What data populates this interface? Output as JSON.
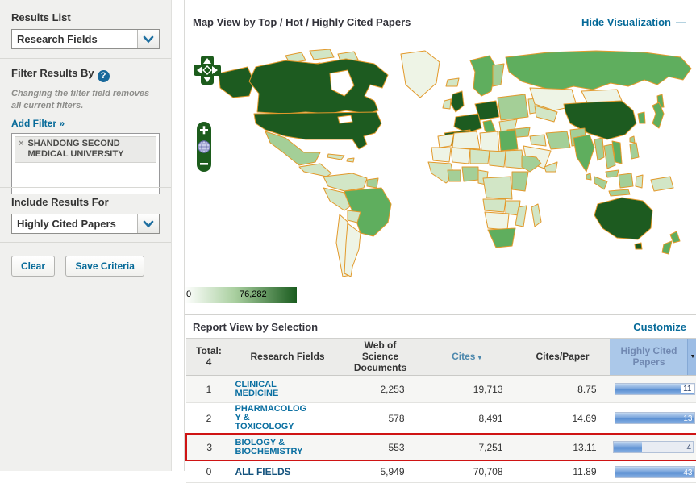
{
  "sidebar": {
    "results_list": {
      "label": "Results List",
      "selected": "Research Fields"
    },
    "filter": {
      "title": "Filter Results By",
      "help_icon": "?",
      "note": "Changing the filter field removes all current filters.",
      "add_filter": "Add Filter »",
      "chip": {
        "remove_icon": "×",
        "label": "SHANDONG SECOND MEDICAL UNIVERSITY"
      }
    },
    "include_results": {
      "label": "Include Results For",
      "selected": "Highly Cited Papers"
    },
    "buttons": {
      "clear": "Clear",
      "save": "Save Criteria"
    }
  },
  "map_panel": {
    "title": "Map View by Top / Hot / Highly Cited Papers",
    "hide_link": "Hide Visualization",
    "hide_dash": "—",
    "controls": {
      "zoom_in": "+",
      "zoom_out": "−",
      "globe_icon": "globe"
    },
    "scale": {
      "min": "0",
      "max": "76,282"
    }
  },
  "report": {
    "title": "Report View by Selection",
    "customize": "Customize",
    "table": {
      "headers": {
        "total": "Total:\n4",
        "research_fields": "Research Fields",
        "documents": "Web of Science\nDocuments",
        "cites": "Cites",
        "cites_sort_icon": "▾",
        "cites_per_paper": "Cites/Paper",
        "highly_cited": "Highly Cited\nPapers",
        "hcp_dropdown_icon": "▼"
      },
      "rows": [
        {
          "rank": "1",
          "field": "CLINICAL\nMEDICINE",
          "docs": "2,253",
          "cites": "19,713",
          "cpp": "8.75",
          "hcp": "11",
          "bar_pct": 90
        },
        {
          "rank": "2",
          "field": "PHARMACOLOG\nY &\nTOXICOLOGY",
          "docs": "578",
          "cites": "8,491",
          "cpp": "14.69",
          "hcp": "13",
          "bar_pct": 100
        },
        {
          "rank": "3",
          "field": "BIOLOGY &\nBIOCHEMISTRY",
          "docs": "553",
          "cites": "7,251",
          "cpp": "13.11",
          "hcp": "4",
          "bar_pct": 36
        },
        {
          "rank": "0",
          "field": "ALL FIELDS",
          "docs": "5,949",
          "cites": "70,708",
          "cpp": "11.89",
          "hcp": "43",
          "bar_pct": 100
        }
      ],
      "highlighted_row_index": 2
    }
  },
  "colors": {
    "link": "#066a99",
    "highlight_border": "#cf1414",
    "bar_blue": "#7aa5dc",
    "hcp_header_bg": "#abc8e9",
    "map_border_orange": "#e2992b",
    "map_dark_green": "#1d5b20",
    "scale_max_green": "#1a5c1f"
  }
}
